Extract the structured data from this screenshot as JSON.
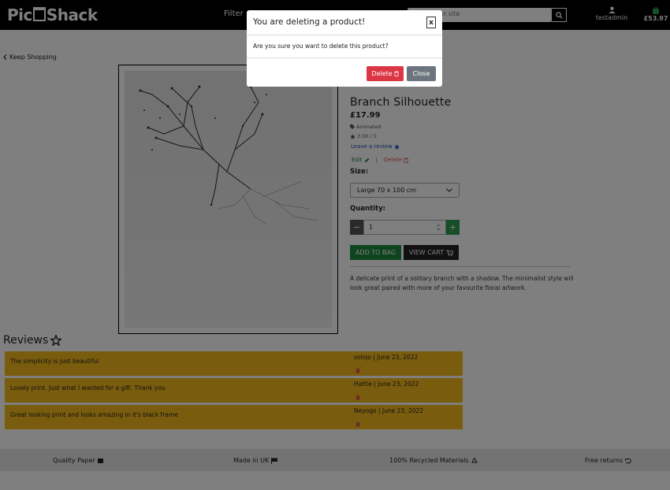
{
  "navbar": {
    "logo_left": "Pic",
    "logo_right": "Shack",
    "filter_label": "Filter",
    "search_placeholder": "Search our site",
    "user_label": "testadmin",
    "bag_total": "£53.97"
  },
  "keep_shopping": "Keep Shopping",
  "product": {
    "title": "Branch Silhouette",
    "price": "£17.99",
    "category": "Animated",
    "rating": "3.00 / 5",
    "leave_review": "Leave a review",
    "edit_label": "Edit",
    "separator": "|",
    "delete_label": "Delete",
    "size_label": "Size:",
    "size_value": "Large 70 x 100 cm",
    "quantity_label": "Quantity:",
    "quantity_value": "1",
    "add_to_bag": "ADD TO BAG",
    "view_cart": "VIEW CART",
    "description": "A delicate print of a solitary branch with a shadow. The minimalist style will look great paired with more of your favourite floral artwork."
  },
  "reviews": {
    "heading": "Reviews",
    "items": [
      {
        "text": "The simplicity is just beautiful",
        "meta": "solojo | June 23, 2022"
      },
      {
        "text": "Lovely print. Just what I wanted for a gift. Thank you",
        "meta": "Hattie | June 23, 2022"
      },
      {
        "text": "Great looking print and looks amazing in it's black frame",
        "meta": "Neyogo | June 23, 2022"
      }
    ]
  },
  "footer": {
    "quality": "Quality Paper",
    "made": "Made in UK",
    "recycled": "100% Recycled Materials",
    "returns": "Free returns"
  },
  "modal": {
    "title": "You are deleting a product!",
    "close_x": "x",
    "body": "Are you sure you want to delete this product?",
    "delete_button": "Delete",
    "close_button": "Close"
  },
  "colors": {
    "review_bg": "#f4b81c",
    "danger": "#dc3545",
    "success": "#1f8b3d",
    "secondary": "#6c757d"
  }
}
